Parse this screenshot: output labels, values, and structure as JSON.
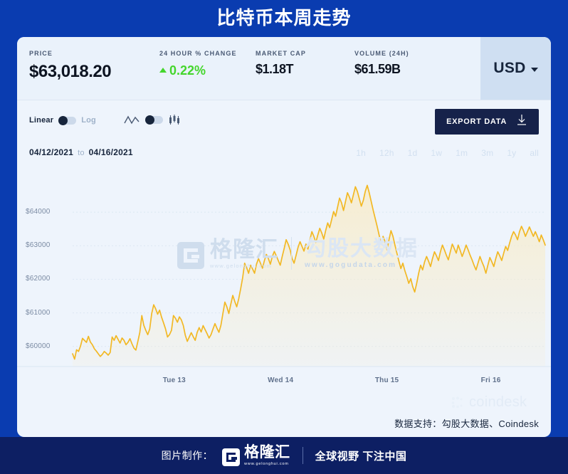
{
  "header": {
    "title": "比特币本周走势"
  },
  "stats": {
    "price": {
      "label": "PRICE",
      "value": "$63,018.20"
    },
    "change": {
      "label": "24 HOUR % CHANGE",
      "value": "0.22%",
      "direction": "up",
      "color": "#44d62c"
    },
    "market_cap": {
      "label": "MARKET CAP",
      "value": "$1.18T"
    },
    "volume": {
      "label": "VOLUME (24H)",
      "value": "$61.59B"
    },
    "currency": {
      "value": "USD",
      "icon": "chevron-down-icon"
    }
  },
  "toolbar": {
    "scale": {
      "active_label": "Linear",
      "inactive_label": "Log",
      "selected": "Linear"
    },
    "chart_type": {
      "line_icon": "line-chart-icon",
      "candle_icon": "candlestick-chart-icon",
      "selected": "line"
    },
    "export": {
      "label": "EXPORT DATA",
      "icon": "download-icon"
    }
  },
  "date_row": {
    "start": "04/12/2021",
    "separator": "to",
    "end": "04/16/2021",
    "periods": [
      "1h",
      "12h",
      "1d",
      "1w",
      "1m",
      "3m",
      "1y",
      "all"
    ]
  },
  "watermark": {
    "brand_cn": "格隆汇",
    "brand_url": "www.gelonghui.com",
    "data_cn": "勾股大数据",
    "data_url": "www.gogudata.com",
    "source_label": "coindesk"
  },
  "attribution": "数据支持：勾股大数据、Coindesk",
  "footer": {
    "made_by": "图片制作：",
    "logo_cn": "格隆汇",
    "logo_url": "www.gelonghui.com",
    "slogan": "全球视野 下注中国"
  },
  "chart_data": {
    "type": "line",
    "title": "比特币本周走势",
    "xlabel": "",
    "ylabel": "",
    "ylim": [
      59400,
      65000
    ],
    "grid": true,
    "legend": "none",
    "line_color": "#f2b824",
    "fill_color": "#f7edcf",
    "ytick_labels": [
      "$64000",
      "$63000",
      "$62000",
      "$61000",
      "$60000"
    ],
    "ytick_values": [
      64000,
      63000,
      62000,
      61000,
      60000
    ],
    "xtick_labels": [
      "Tue 13",
      "Wed 14",
      "Thu 15",
      "Fri 16"
    ],
    "xtick_positions": [
      0.215,
      0.44,
      0.665,
      0.885
    ],
    "date_range": "04/12/2021 to 04/16/2021",
    "last_value": 63018.2,
    "values": [
      59780,
      59620,
      59900,
      59850,
      60010,
      60240,
      60180,
      60120,
      60300,
      60130,
      60050,
      59930,
      59860,
      59780,
      59700,
      59760,
      59850,
      59800,
      59740,
      59820,
      60280,
      60180,
      60320,
      60210,
      60100,
      60250,
      60180,
      60050,
      60120,
      60230,
      60080,
      59950,
      59890,
      60150,
      60420,
      60920,
      60630,
      60480,
      60350,
      60520,
      60980,
      61240,
      61120,
      60960,
      61080,
      60870,
      60700,
      60520,
      60280,
      60350,
      60480,
      60920,
      60840,
      60720,
      60880,
      60790,
      60620,
      60330,
      60150,
      60280,
      60410,
      60290,
      60180,
      60420,
      60560,
      60430,
      60620,
      60500,
      60380,
      60250,
      60350,
      60520,
      60680,
      60540,
      60420,
      60630,
      60980,
      61320,
      61180,
      60980,
      61260,
      61520,
      61340,
      61180,
      61420,
      61720,
      62050,
      62480,
      62350,
      62180,
      62420,
      62310,
      62180,
      62450,
      62620,
      62480,
      62330,
      62560,
      62740,
      62620,
      62450,
      62680,
      62830,
      62700,
      62560,
      62420,
      62680,
      62920,
      63180,
      63050,
      62880,
      62620,
      62480,
      62710,
      62950,
      63120,
      62980,
      62840,
      63050,
      62900,
      63180,
      63420,
      63280,
      63100,
      63320,
      63520,
      63380,
      63200,
      63460,
      63680,
      63540,
      63780,
      64020,
      63880,
      64150,
      64420,
      64280,
      64050,
      64320,
      64580,
      64450,
      64280,
      64520,
      64760,
      64620,
      64400,
      64180,
      64350,
      64620,
      64800,
      64580,
      64320,
      64060,
      63820,
      63580,
      63320,
      63080,
      63280,
      63120,
      62880,
      63180,
      63450,
      63280,
      63020,
      62780,
      62540,
      62320,
      62480,
      62260,
      62080,
      61880,
      62020,
      61780,
      61620,
      61880,
      62180,
      62420,
      62280,
      62520,
      62680,
      62540,
      62380,
      62620,
      62820,
      62700,
      62560,
      62820,
      63020,
      62880,
      62720,
      62580,
      62820,
      63050,
      62920,
      62780,
      63020,
      62860,
      62680,
      62840,
      63020,
      62880,
      62720,
      62580,
      62420,
      62280,
      62480,
      62680,
      62520,
      62380,
      62180,
      62420,
      62650,
      62520,
      62380,
      62620,
      62820,
      62700,
      62560,
      62780,
      62980,
      62860,
      63080,
      63280,
      63420,
      63320,
      63180,
      63420,
      63580,
      63450,
      63280,
      63420,
      63560,
      63420,
      63280,
      63420,
      63280,
      63120,
      63320,
      63180,
      63018
    ]
  }
}
